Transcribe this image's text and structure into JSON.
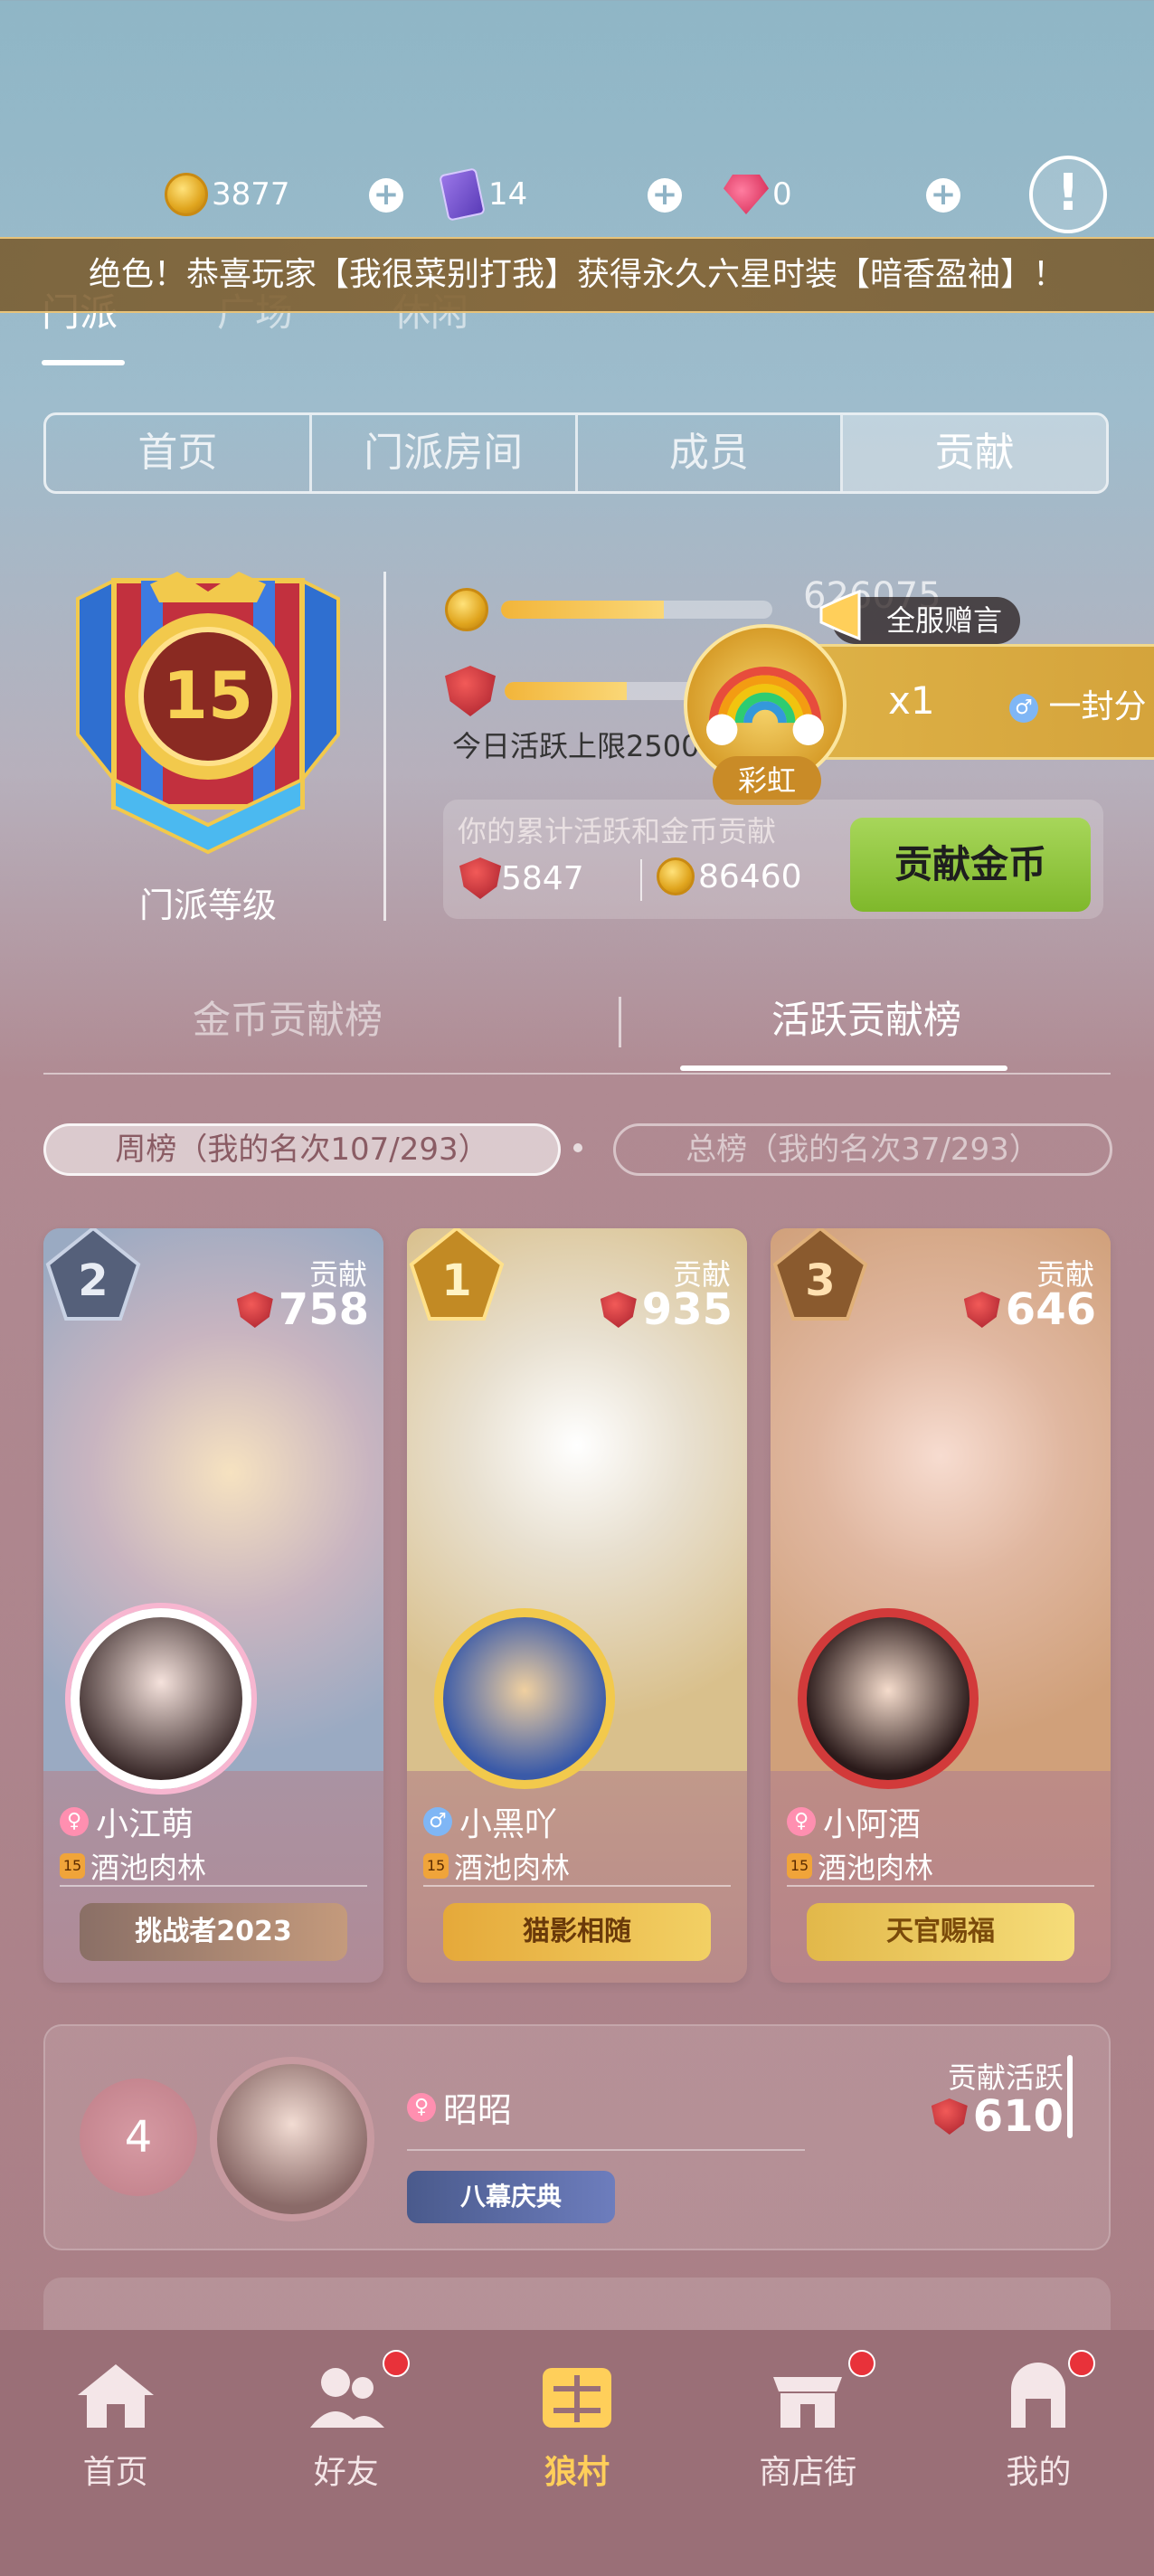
{
  "currency": {
    "coins": "3877",
    "cards": "14",
    "gems": "0"
  },
  "marquee": "绝色！恭喜玩家【我很菜别打我】获得永久六星时装【暗香盈袖】！",
  "top_tabs": [
    "门派",
    "广场",
    "休闲"
  ],
  "segment_tabs": [
    "首页",
    "门派房间",
    "成员",
    "贡献"
  ],
  "sect": {
    "level": "15",
    "level_label": "门派等级",
    "partial_number": "626075",
    "daily_limit": "今日活跃上限2500",
    "contrib_title": "你的累计活跃和金币贡献",
    "activity_total": "5847",
    "coin_total": "86460",
    "contrib_button": "贡献金币"
  },
  "gift_popup": {
    "broadcast_label": "全服赠言",
    "gift_name": "彩虹",
    "count": "x1",
    "message": "一封分"
  },
  "rank_tabs": [
    "金币贡献榜",
    "活跃贡献榜"
  ],
  "rank_pills": {
    "weekly": "周榜（我的名次107/293）",
    "total": "总榜（我的名次37/293）"
  },
  "top3": [
    {
      "rank": "2",
      "contrib_label": "贡献",
      "value": "758",
      "name": "小江萌",
      "gender": "female",
      "guild": "酒池肉林",
      "title_badge": "挑战者2023",
      "colors": {
        "art": "#a6b5c9",
        "rank": "#55607a"
      }
    },
    {
      "rank": "1",
      "contrib_label": "贡献",
      "value": "935",
      "name": "小黑吖",
      "gender": "male",
      "guild": "酒池肉林",
      "title_badge": "猫影相随",
      "colors": {
        "art": "#d8c08a",
        "rank": "#c28a24"
      }
    },
    {
      "rank": "3",
      "contrib_label": "贡献",
      "value": "646",
      "name": "小阿酒",
      "gender": "female",
      "guild": "酒池肉林",
      "title_badge": "天官赐福",
      "colors": {
        "art": "#d0a07a",
        "rank": "#8a5a2e"
      }
    }
  ],
  "row4": {
    "rank": "4",
    "name": "昭昭",
    "badge": "八幕庆典",
    "contrib_label": "贡献活跃",
    "value": "610"
  },
  "bottom_nav": [
    {
      "label": "首页",
      "icon": "home-icon",
      "badge": false
    },
    {
      "label": "好友",
      "icon": "friends-icon",
      "badge": true
    },
    {
      "label": "狼村",
      "icon": "village-icon",
      "badge": false,
      "active": true
    },
    {
      "label": "商店街",
      "icon": "shop-icon",
      "badge": true
    },
    {
      "label": "我的",
      "icon": "profile-icon",
      "badge": true
    }
  ]
}
